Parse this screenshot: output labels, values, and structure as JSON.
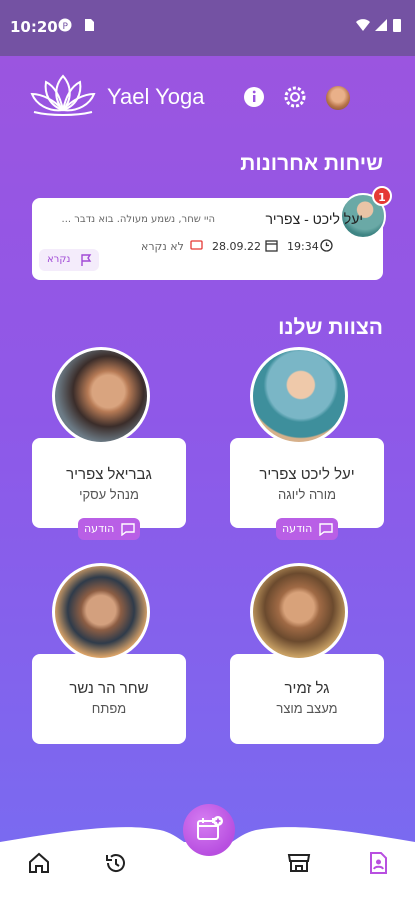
{
  "status_bar": {
    "time": "10:20"
  },
  "header": {
    "app_name": "Yael Yoga"
  },
  "recent_chats": {
    "title": "שיחות אחרונות",
    "items": [
      {
        "name": "יעל ליכט - צפריר",
        "preview": "היי שחר, נשמע מעולה. בוא נדבר ...",
        "time": "19:34",
        "date": "28.09.22",
        "status": "לא נקרא",
        "mark_read_label": "נקרא",
        "unread_count": "1"
      }
    ]
  },
  "team": {
    "title": "הצוות שלנו",
    "members": [
      {
        "name": "יעל ליכט צפריר",
        "role": "מורה ליוגה",
        "message_label": "הודעה"
      },
      {
        "name": "גבריאל צפריר",
        "role": "מנהל עסקי",
        "message_label": "הודעה"
      },
      {
        "name": "גל זמיר",
        "role": "מעצב מוצר"
      },
      {
        "name": "שחר הר נשר",
        "role": "מפתח"
      }
    ]
  },
  "bottom_nav": {
    "items": [
      "home-icon",
      "history-icon",
      "calendar-add-icon",
      "store-icon",
      "contact-card-icon"
    ],
    "active": "contact-card-icon"
  },
  "colors": {
    "accent": "#b95fe6",
    "header": "#7452a3",
    "badge": "#e53935"
  }
}
